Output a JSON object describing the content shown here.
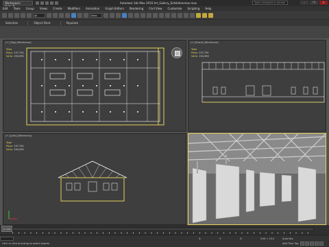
{
  "window": {
    "workspace": "Workspace: Default",
    "title": "Autodesk 3ds Max 2016    Art_Gallery_Exhibitionmax.max",
    "search_placeholder": "Type a keyword or phrase",
    "controls": [
      "–",
      "❐",
      "✕"
    ]
  },
  "menu": {
    "items": [
      "Edit",
      "Tools",
      "Group",
      "Views",
      "Create",
      "Modifiers",
      "Animation",
      "Graph Editors",
      "Rendering",
      "Civil View",
      "Customize",
      "Scripting",
      "Help"
    ]
  },
  "toolbar": {
    "selection_filter": "All",
    "view_dropdown": "View"
  },
  "ribbon": {
    "tabs": [
      "Selection",
      "Object Paint",
      "Populate"
    ]
  },
  "viewports": {
    "top": {
      "label": "[+] [Top] [Wireframe]",
      "stats_total": "Total",
      "polys_label": "Polys:",
      "polys": "137,791",
      "verts_label": "Verts:",
      "verts": "194,590"
    },
    "front": {
      "label": "[+] [Front] [Wireframe]",
      "stats_total": "Total",
      "polys_label": "Polys:",
      "polys": "137,791",
      "verts_label": "Verts:",
      "verts": "194,590"
    },
    "left": {
      "label": "[+] [Left] [Wireframe]",
      "stats_total": "Total",
      "polys_label": "Polys:",
      "polys": "137,791",
      "verts_label": "Verts:",
      "verts": "194,590"
    },
    "perspective": {
      "label": "[+] [Perspective] [Realistic]"
    }
  },
  "timeline": {
    "frame_display": "0 / 100",
    "progress": 0
  },
  "status": {
    "message": "Click or click-and-drag to select objects",
    "coords": [
      "X:",
      "Y:",
      "Z:"
    ],
    "grid": "Grid = 10.0",
    "add_time_tag": "Add Time Tag",
    "auto_key": "Auto Key",
    "selected": "Selected"
  },
  "colors": {
    "accent": "#e8d25a",
    "viewport_bg": "#3e3e3e",
    "wire": "#ffffff"
  }
}
